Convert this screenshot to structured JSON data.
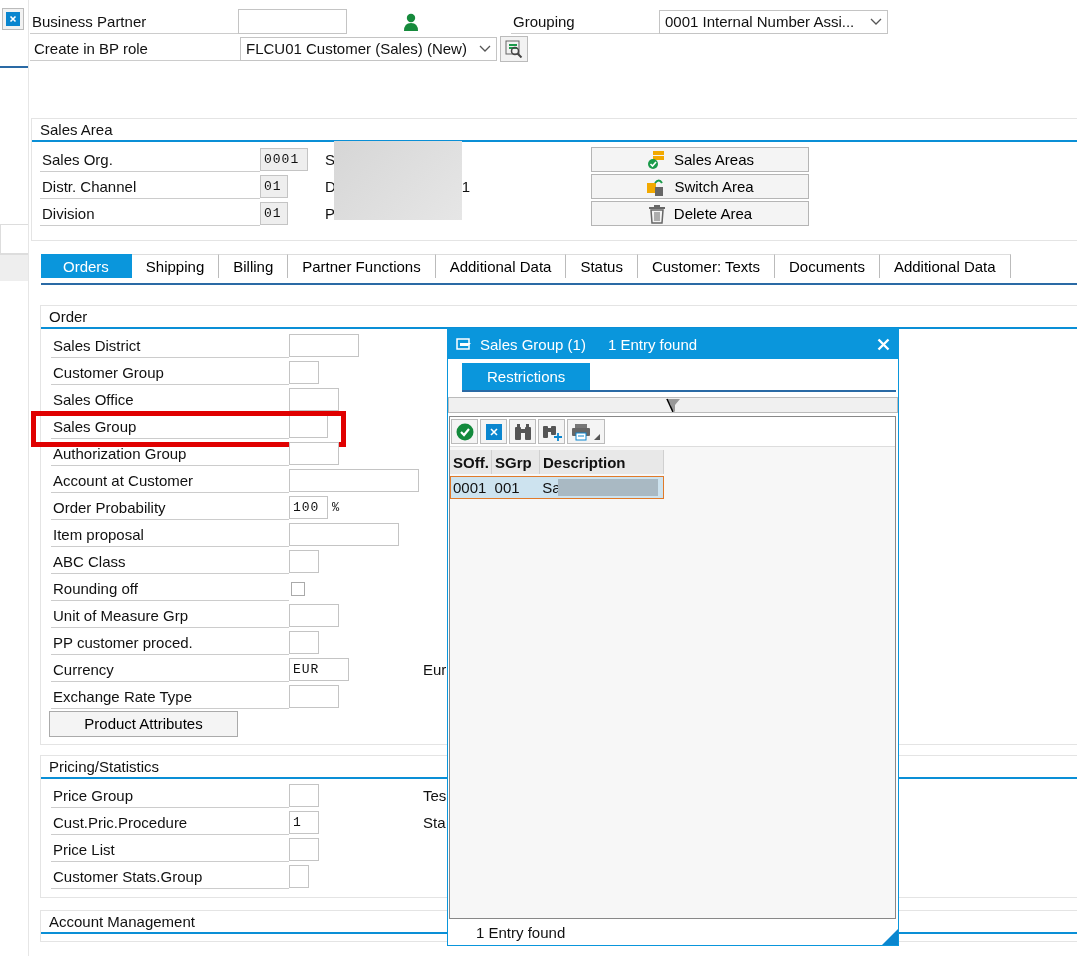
{
  "header": {
    "partner_label": "Business Partner",
    "grouping_label": "Grouping",
    "grouping_value": "0001 Internal Number Assi...",
    "role_label": "Create in BP role",
    "role_value": "FLCU01 Customer (Sales) (New)"
  },
  "sales_area": {
    "title": "Sales Area",
    "rows": [
      {
        "label": "Sales Org.",
        "value": "0001",
        "description": "S"
      },
      {
        "label": "Distr. Channel",
        "value": "01",
        "description": "D",
        "description_end": "1"
      },
      {
        "label": "Division",
        "value": "01",
        "description": "P"
      }
    ],
    "buttons": [
      {
        "label": "Sales Areas",
        "kind": "check"
      },
      {
        "label": "Switch Area",
        "kind": "switch"
      },
      {
        "label": "Delete Area",
        "kind": "delete"
      }
    ]
  },
  "tabs": [
    {
      "label": "Orders",
      "selected": true
    },
    {
      "label": "Shipping",
      "selected": false
    },
    {
      "label": "Billing",
      "selected": false
    },
    {
      "label": "Partner Functions",
      "selected": false
    },
    {
      "label": "Additional Data",
      "selected": false
    },
    {
      "label": "Status",
      "selected": false
    },
    {
      "label": "Customer: Texts",
      "selected": false
    },
    {
      "label": "Documents",
      "selected": false
    },
    {
      "label": "Additional Data",
      "selected": false
    }
  ],
  "order": {
    "title": "Order",
    "rows": [
      {
        "kind": "field",
        "label": "Sales District",
        "highlighted": false
      },
      {
        "kind": "field",
        "label": "Customer Group",
        "highlighted": false
      },
      {
        "kind": "field",
        "label": "Sales Office",
        "highlighted": false
      },
      {
        "kind": "field",
        "label": "Sales Group",
        "highlighted": true
      },
      {
        "kind": "field",
        "label": "Authorization Group",
        "highlighted": false
      },
      {
        "kind": "field",
        "label": "Account at Customer",
        "highlighted": false
      },
      {
        "kind": "field",
        "label": "Order Probability",
        "value": "100",
        "unit": "%",
        "highlighted": false
      },
      {
        "kind": "field",
        "label": "Item proposal",
        "highlighted": false
      },
      {
        "kind": "field",
        "label": "ABC Class",
        "highlighted": false
      },
      {
        "kind": "checkbox",
        "label": "Rounding off",
        "checked": false,
        "highlighted": false
      },
      {
        "kind": "field",
        "label": "Unit of Measure Grp",
        "highlighted": false
      },
      {
        "kind": "field",
        "label": "PP customer proced.",
        "highlighted": false
      },
      {
        "kind": "field",
        "label": "Currency",
        "value": "EUR",
        "side_text": "Eur",
        "highlighted": false
      },
      {
        "kind": "field",
        "label": "Exchange Rate Type",
        "highlighted": false
      },
      {
        "kind": "button",
        "label": "Product Attributes",
        "highlighted": false
      }
    ]
  },
  "pricing": {
    "title": "Pricing/Statistics",
    "rows": [
      {
        "kind": "field",
        "label": "Price Group",
        "side_text": "Tes",
        "highlighted": false
      },
      {
        "kind": "field",
        "label": "Cust.Pric.Procedure",
        "value": "1",
        "side_text": "Sta",
        "highlighted": false
      },
      {
        "kind": "field",
        "label": "Price List",
        "highlighted": false
      },
      {
        "kind": "field",
        "label": "Customer Stats.Group",
        "highlighted": false
      }
    ]
  },
  "account_management": {
    "title": "Account Management"
  },
  "popup": {
    "title": "Sales Group (1)",
    "subtitle": "1 Entry found",
    "tabs": [
      {
        "label": "Restrictions",
        "selected": true
      }
    ],
    "columns": [
      "SOff.",
      "SGrp",
      "Description"
    ],
    "rows": [
      {
        "cells": [
          "0001",
          "001",
          "Sa"
        ],
        "selected": true
      }
    ],
    "status": "1 Entry found"
  }
}
